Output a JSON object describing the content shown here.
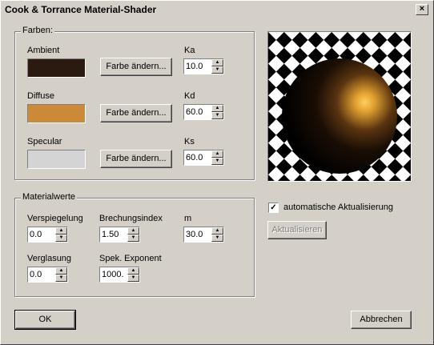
{
  "window": {
    "title": "Cook & Torrance Material-Shader",
    "close_glyph": "×"
  },
  "farben": {
    "legend": "Farben:",
    "ambient": {
      "label": "Ambient",
      "color": "#2a1a10",
      "button": "Farbe ändern...",
      "coef_label": "Ka",
      "coef_value": "10.0"
    },
    "diffuse": {
      "label": "Diffuse",
      "color": "#cc8a38",
      "button": "Farbe ändern...",
      "coef_label": "Kd",
      "coef_value": "60.0"
    },
    "specular": {
      "label": "Specular",
      "color": "#d4d4d4",
      "button": "Farbe ändern...",
      "coef_label": "Ks",
      "coef_value": "60.0"
    }
  },
  "materialwerte": {
    "legend": "Materialwerte",
    "verspiegelung": {
      "label": "Verspiegelung",
      "value": "0.0"
    },
    "brechungsindex": {
      "label": "Brechungsindex",
      "value": "1.50"
    },
    "m": {
      "label": "m",
      "value": "30.0"
    },
    "verglasung": {
      "label": "Verglasung",
      "value": "0.0"
    },
    "spek_exponent": {
      "label": "Spek. Exponent",
      "value": "1000."
    }
  },
  "preview": {
    "checker_dark": "#000000",
    "checker_light": "#ffffff",
    "sphere_highlight": "#ffd060"
  },
  "auto_update": {
    "label": "automatische Aktualisierung",
    "checked": true,
    "check_glyph": "✓"
  },
  "buttons": {
    "update": "Aktualisieren",
    "ok": "OK",
    "cancel": "Abbrechen"
  },
  "spin_glyphs": {
    "up": "▲",
    "down": "▼"
  }
}
